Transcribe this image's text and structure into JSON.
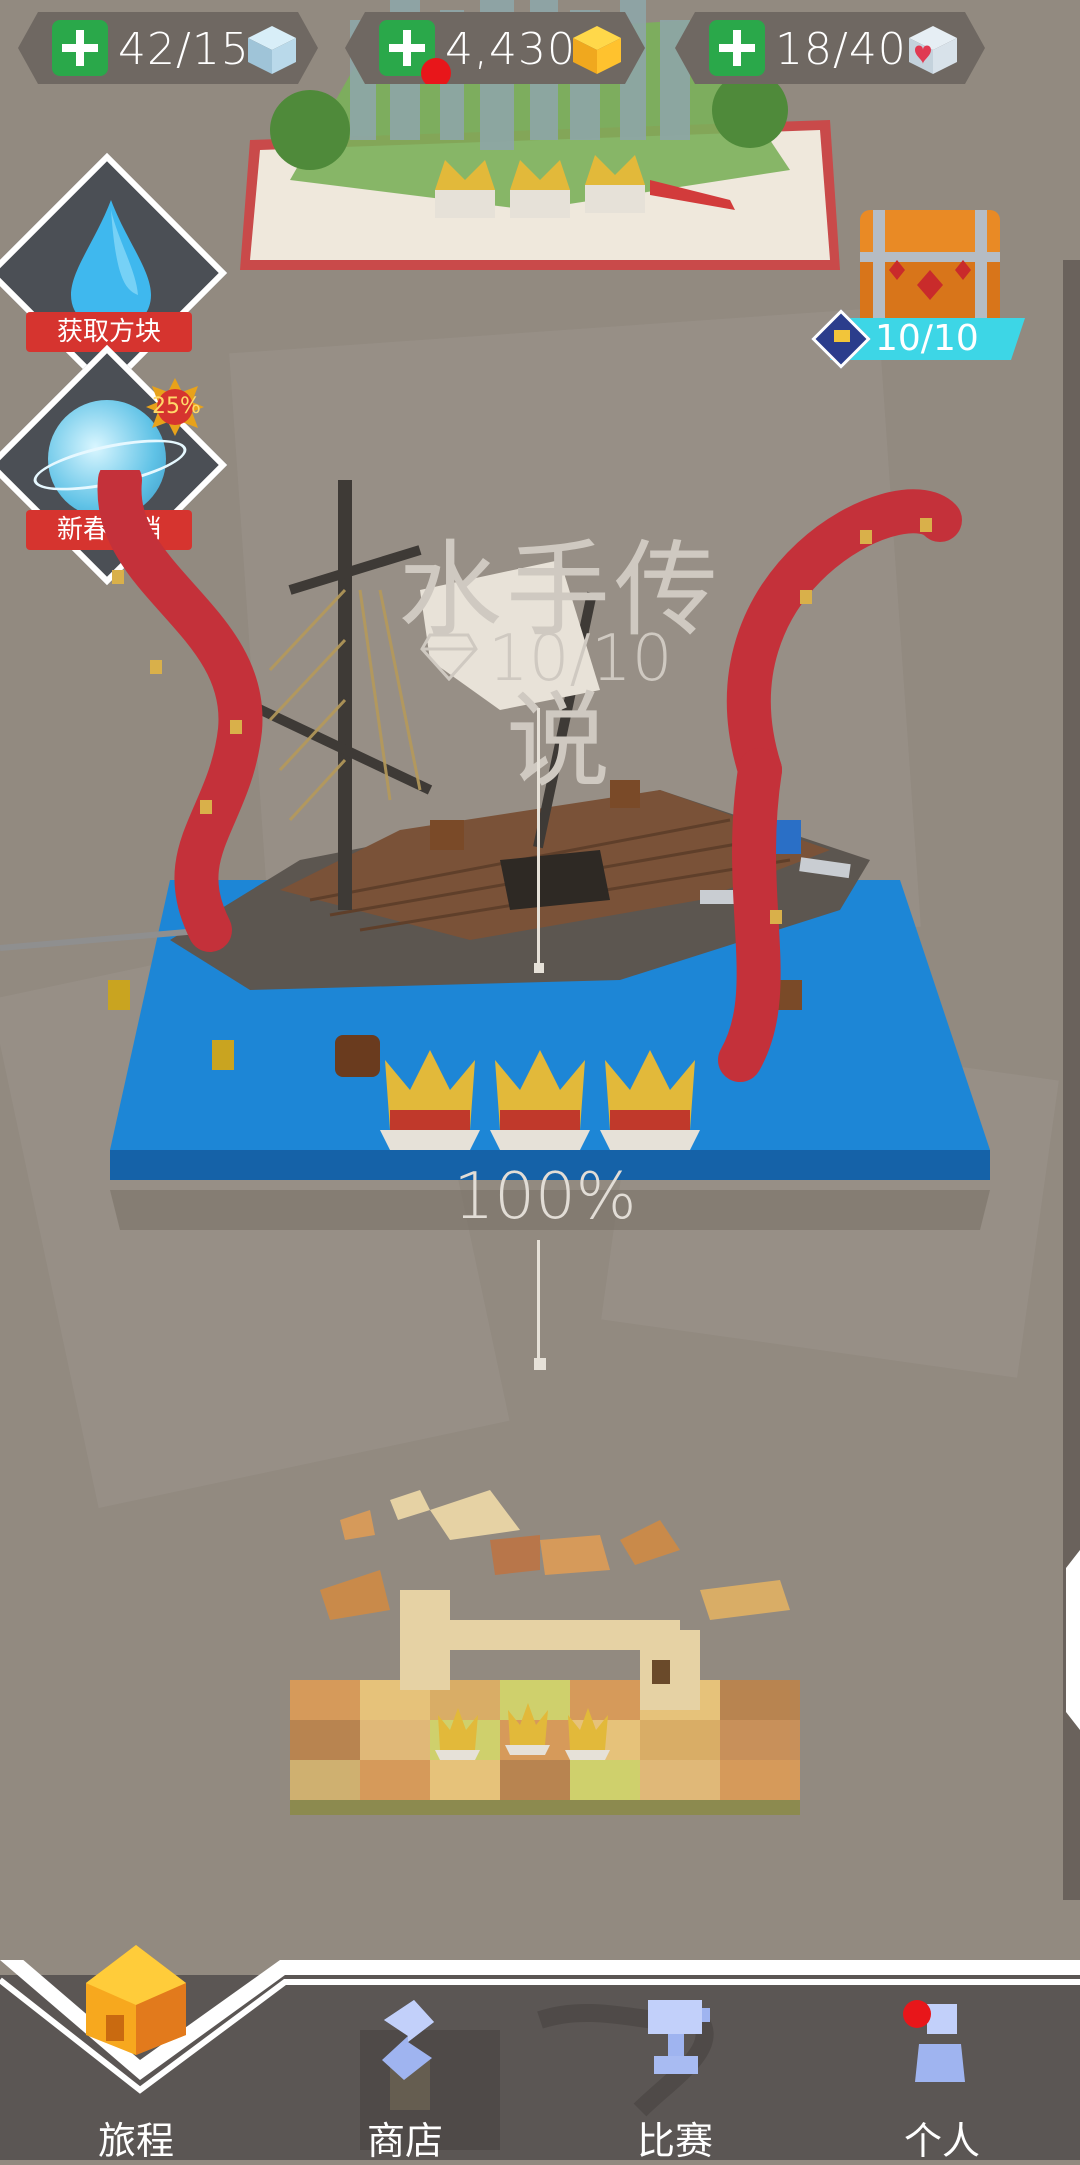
{
  "resources": {
    "blocks": "42/15",
    "coins": "4,430",
    "hearts": "18/40"
  },
  "side_buttons": {
    "get_blocks": "获取方块",
    "promo": "新春促销",
    "promo_badge": "25%"
  },
  "chest": {
    "progress": "10/10"
  },
  "level": {
    "title": "水手传说",
    "gems": "10/10",
    "completion": "100%"
  },
  "nav": {
    "journey": "旅程",
    "shop": "商店",
    "contest": "比赛",
    "profile": "个人"
  },
  "colors": {
    "background": "#928a80",
    "plus_green": "#2aa84a",
    "badge_red": "#d6342f",
    "sea_blue": "#1d86d6",
    "progress_cyan": "#3dd6e6",
    "nav_bg": "#5b5654"
  }
}
